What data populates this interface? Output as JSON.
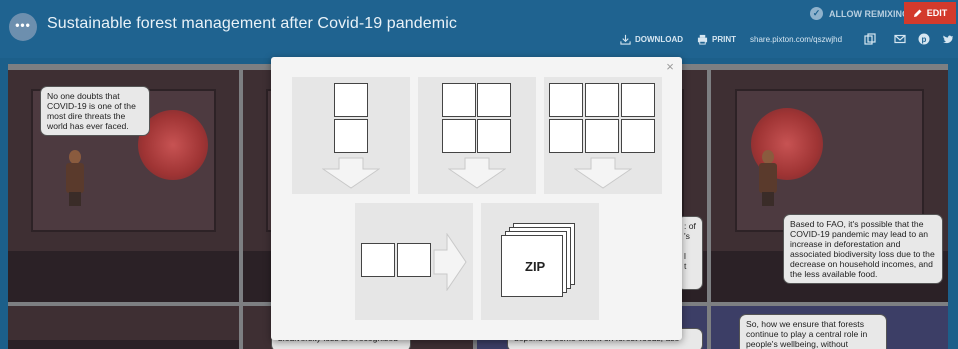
{
  "header": {
    "menu_icon": "ellipsis-icon",
    "menu_glyph": "•••",
    "title": "Sustainable forest management after Covid-19 pandemic",
    "allow_remixing": "ALLOW REMIXING",
    "edit": "EDIT",
    "download": "DOWNLOAD",
    "print": "PRINT",
    "share_url": "share.pixton.com/qszwjhd",
    "edit_color": "#d33a2c"
  },
  "comic": {
    "bubbles": {
      "p1": "No one doubts that COVID-19 is one of the most dire threats the world has ever faced.",
      "p4": "Based to FAO, it's possible that the COVID-19 pandemic may lead to an increase in deforestation and associated biodiversity loss due to the decrease on household incomes, and the less available food.",
      "p3_partial": ": of\n's\n\nl\nt",
      "p6": "biodiversity loss are recognised",
      "p7": "depend to some extent on forest foods, use",
      "p8": "So, how we ensure that forests continue to play a central role in people's wellbeing, without"
    }
  },
  "modal": {
    "close": "×",
    "zip_label": "ZIP",
    "options": [
      {
        "name": "vertical-strip",
        "icon": "arrow-down-icon"
      },
      {
        "name": "two-by-two-grid",
        "icon": "arrow-down-icon"
      },
      {
        "name": "three-by-two-grid",
        "icon": "arrow-down-icon"
      },
      {
        "name": "horizontal-strip",
        "icon": "arrow-right-icon"
      },
      {
        "name": "zip-archive",
        "icon": "zip-stack-icon"
      }
    ]
  }
}
